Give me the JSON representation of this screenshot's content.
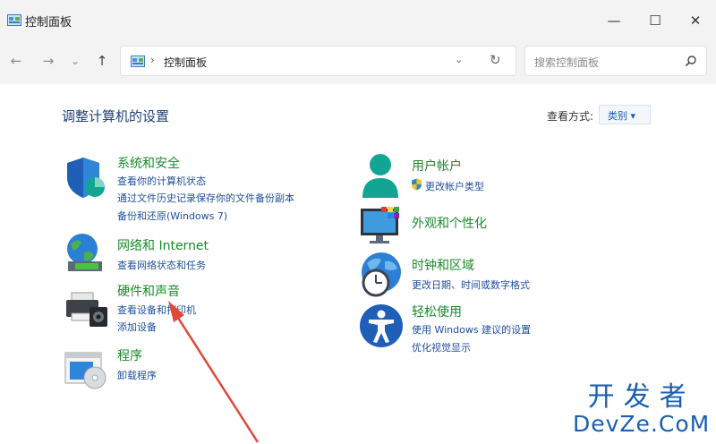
{
  "window": {
    "title": "控制面板",
    "minimize_glyph": "—",
    "maximize_glyph": "☐",
    "close_glyph": "✕"
  },
  "navigation": {
    "back_icon": "←",
    "forward_icon": "→",
    "history_icon": "⌄",
    "up_icon": "↑"
  },
  "address": {
    "separator": "›",
    "path": "控制面板",
    "dropdown_icon": "⌄",
    "refresh_icon": "↻"
  },
  "search": {
    "placeholder": "搜索控制面板"
  },
  "main": {
    "heading": "调整计算机的设置",
    "view_label": "查看方式:",
    "view_value": "类别 ▾"
  },
  "categories": {
    "system_security": {
      "title": "系统和安全",
      "links": [
        "查看你的计算机状态",
        "通过文件历史记录保存你的文件备份副本",
        "备份和还原(Windows 7)"
      ]
    },
    "network": {
      "title": "网络和 Internet",
      "links": [
        "查看网络状态和任务"
      ]
    },
    "hardware": {
      "title": "硬件和声音",
      "links": [
        "查看设备和打印机",
        "添加设备"
      ]
    },
    "programs": {
      "title": "程序",
      "links": [
        "卸载程序"
      ]
    },
    "user_accounts": {
      "title": "用户帐户",
      "links": [
        "更改帐户类型"
      ]
    },
    "appearance": {
      "title": "外观和个性化",
      "links": []
    },
    "clock_region": {
      "title": "时钟和区域",
      "links": [
        "更改日期、时间或数字格式"
      ]
    },
    "ease_of_access": {
      "title": "轻松使用",
      "links": [
        "使用 Windows 建议的设置",
        "优化视觉显示"
      ]
    }
  },
  "watermark": {
    "line1": "开发者",
    "line2": "DevZe.CoM"
  },
  "colors": {
    "accent_red": "#e0483a",
    "category_green": "#188a2a",
    "link_blue": "#1f4e9b",
    "heading_blue": "#1f3f74",
    "icon_teal": "#129a8a"
  },
  "icons": {
    "app": "control-panel-icon",
    "system_security": "shield-icon",
    "network": "globe-network-icon",
    "hardware": "printer-speaker-icon",
    "programs": "programs-disc-icon",
    "user_accounts": "user-icon",
    "appearance": "monitor-icon",
    "clock_region": "globe-clock-icon",
    "ease_of_access": "accessibility-icon",
    "uac": "uac-shield-icon",
    "search": "search-icon"
  }
}
